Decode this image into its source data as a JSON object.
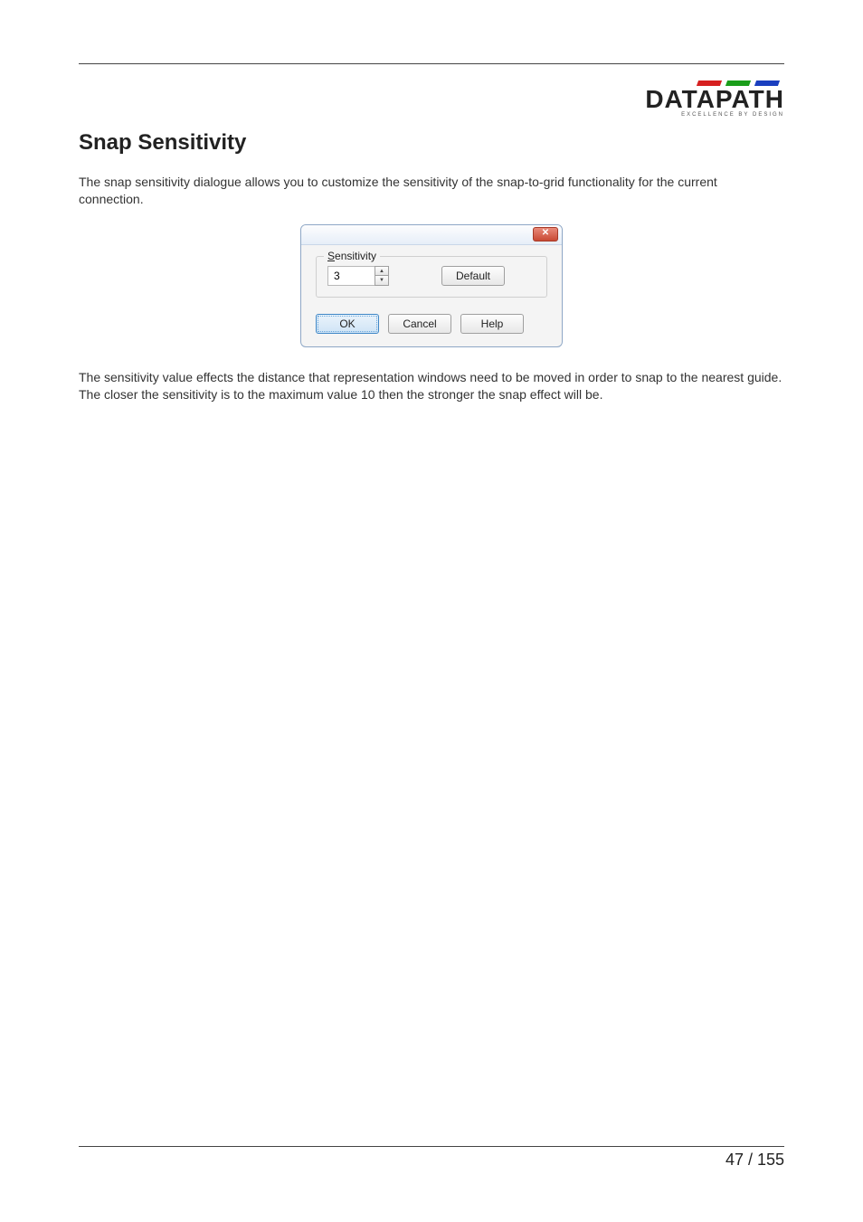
{
  "logo": {
    "name": "DATAPATH",
    "tagline": "EXCELLENCE BY DESIGN"
  },
  "heading": "Snap Sensitivity",
  "intro": "The snap sensitivity dialogue allows you to customize the sensitivity of the snap-to-grid functionality for the current connection.",
  "dialog": {
    "legend_prefix_underlined": "S",
    "legend_rest": "ensitivity",
    "value": "3",
    "default_btn": "Default",
    "ok": "OK",
    "cancel": "Cancel",
    "help": "Help",
    "close_glyph": "✕"
  },
  "para2": "The sensitivity value effects the distance that representation windows need to be moved in order to snap to the nearest guide. The closer the sensitivity is to the maximum value 10 then the stronger the snap effect will be.",
  "page_number": "47 / 155"
}
